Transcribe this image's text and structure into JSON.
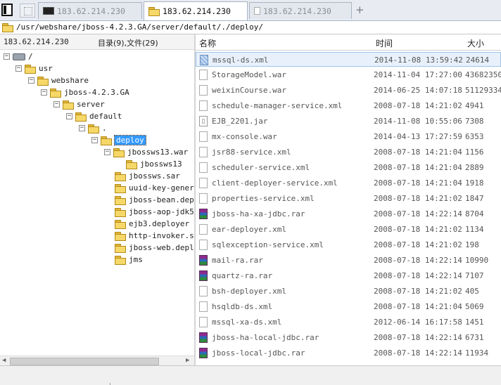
{
  "tabs": [
    {
      "label": "183.62.214.230",
      "icon": "terminal-icon",
      "active": false
    },
    {
      "label": "183.62.214.230",
      "icon": "folder-icon",
      "active": true
    },
    {
      "label": "183.62.214.230",
      "icon": "document-icon",
      "active": false
    }
  ],
  "new_tab_label": "+",
  "path": "/usr/webshare/jboss-4.2.3.GA/server/default/./deploy/",
  "left_header": {
    "host": "183.62.214.230",
    "summary": "目录(9),文件(29)"
  },
  "tree": [
    {
      "label": "/",
      "toggle": "−",
      "icon": "drive-icon"
    },
    {
      "label": "usr",
      "toggle": "−"
    },
    {
      "label": "webshare",
      "toggle": "−"
    },
    {
      "label": "jboss-4.2.3.GA",
      "toggle": "−"
    },
    {
      "label": "server",
      "toggle": "−"
    },
    {
      "label": "default",
      "toggle": "−"
    },
    {
      "label": ".",
      "toggle": "−"
    },
    {
      "label": "deploy",
      "toggle": "−",
      "selected": true
    },
    {
      "label": "jbossws13.war",
      "toggle": "−"
    },
    {
      "label": "jbossws13",
      "toggle": ""
    },
    {
      "label": "jbossws.sar",
      "toggle": ""
    },
    {
      "label": "uuid-key-generator.sar",
      "toggle": ""
    },
    {
      "label": "jboss-bean.deployer",
      "toggle": ""
    },
    {
      "label": "jboss-aop-jdk50.deployer",
      "toggle": ""
    },
    {
      "label": "ejb3.deployer",
      "toggle": ""
    },
    {
      "label": "http-invoker.sar",
      "toggle": ""
    },
    {
      "label": "jboss-web.deployer",
      "toggle": ""
    },
    {
      "label": "jms",
      "toggle": ""
    }
  ],
  "columns": {
    "name": "名称",
    "time": "时间",
    "size": "大小"
  },
  "files": [
    {
      "name": "mssql-ds.xml",
      "time": "2014-11-08 13:59:42",
      "size": "24614",
      "icon": "xml-file-icon",
      "selected": true
    },
    {
      "name": "StorageModel.war",
      "time": "2014-11-04 17:27:00",
      "size": "43682350",
      "icon": "file-icon"
    },
    {
      "name": "weixinCourse.war",
      "time": "2014-06-25 14:07:18",
      "size": "51129334",
      "icon": "file-icon"
    },
    {
      "name": "schedule-manager-service.xml",
      "time": "2008-07-18 14:21:02",
      "size": "4941",
      "icon": "file-icon"
    },
    {
      "name": "EJB_2201.jar",
      "time": "2014-11-08 10:55:06",
      "size": "7308",
      "icon": "jar-file-icon"
    },
    {
      "name": "mx-console.war",
      "time": "2014-04-13 17:27:59",
      "size": "6353",
      "icon": "file-icon"
    },
    {
      "name": "jsr88-service.xml",
      "time": "2008-07-18 14:21:04",
      "size": "1156",
      "icon": "file-icon"
    },
    {
      "name": "scheduler-service.xml",
      "time": "2008-07-18 14:21:04",
      "size": "2889",
      "icon": "file-icon"
    },
    {
      "name": "client-deployer-service.xml",
      "time": "2008-07-18 14:21:04",
      "size": "1918",
      "icon": "file-icon"
    },
    {
      "name": "properties-service.xml",
      "time": "2008-07-18 14:21:02",
      "size": "1847",
      "icon": "file-icon"
    },
    {
      "name": "jboss-ha-xa-jdbc.rar",
      "time": "2008-07-18 14:22:14",
      "size": "8704",
      "icon": "rar-file-icon"
    },
    {
      "name": "ear-deployer.xml",
      "time": "2008-07-18 14:21:02",
      "size": "1134",
      "icon": "file-icon"
    },
    {
      "name": "sqlexception-service.xml",
      "time": "2008-07-18 14:21:02",
      "size": "198",
      "icon": "file-icon"
    },
    {
      "name": "mail-ra.rar",
      "time": "2008-07-18 14:22:14",
      "size": "10990",
      "icon": "rar-file-icon"
    },
    {
      "name": "quartz-ra.rar",
      "time": "2008-07-18 14:22:14",
      "size": "7107",
      "icon": "rar-file-icon"
    },
    {
      "name": "bsh-deployer.xml",
      "time": "2008-07-18 14:21:02",
      "size": "405",
      "icon": "file-icon"
    },
    {
      "name": "hsqldb-ds.xml",
      "time": "2008-07-18 14:21:04",
      "size": "5069",
      "icon": "file-icon"
    },
    {
      "name": "mssql-xa-ds.xml",
      "time": "2012-06-14 16:17:58",
      "size": "1451",
      "icon": "file-icon"
    },
    {
      "name": "jboss-ha-local-jdbc.rar",
      "time": "2008-07-18 14:22:14",
      "size": "6731",
      "icon": "rar-file-icon"
    },
    {
      "name": "jboss-local-jdbc.rar",
      "time": "2008-07-18 14:22:14",
      "size": "11934",
      "icon": "rar-file-icon"
    }
  ],
  "colors": {
    "accent": "#3399ff",
    "selected_row": "#e8f1fb",
    "folder": "#f6d869",
    "tab_bar": "#e8ecf2"
  }
}
